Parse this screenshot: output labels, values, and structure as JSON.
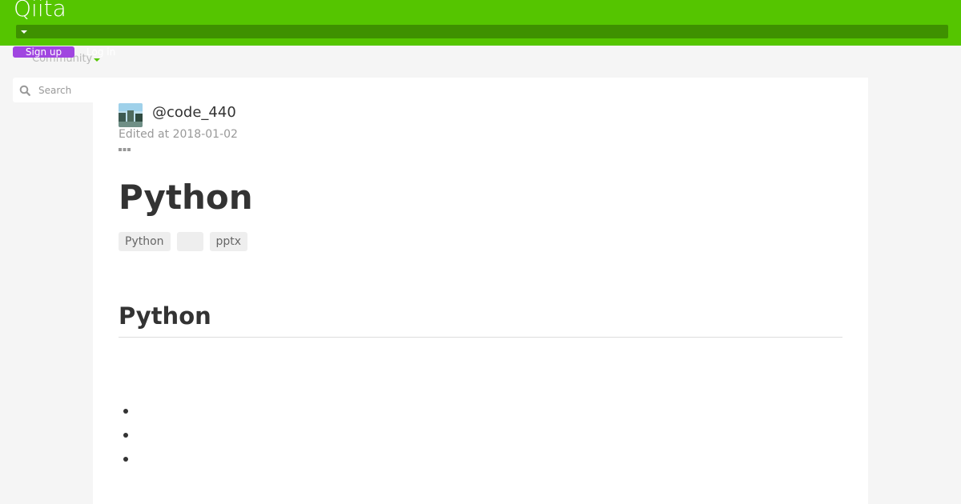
{
  "header": {
    "logo_text": "Qiita",
    "community_label": "Community",
    "signup_label": "Sign up",
    "login_label": "Log in"
  },
  "search": {
    "placeholder": "Search"
  },
  "article": {
    "author": "@code_440",
    "edited": "Edited at 2018-01-02",
    "title": "Python",
    "tags": [
      "Python",
      "",
      "pptx"
    ],
    "section_heading": "Python",
    "bullets": [
      "",
      "",
      ""
    ]
  },
  "colors": {
    "brand": "#55c500",
    "brand_dark": "#3e9100",
    "signup": "#a046e0"
  },
  "icons": {
    "search": "search-icon",
    "more": "more-icon",
    "caret": "caret-down-icon"
  }
}
